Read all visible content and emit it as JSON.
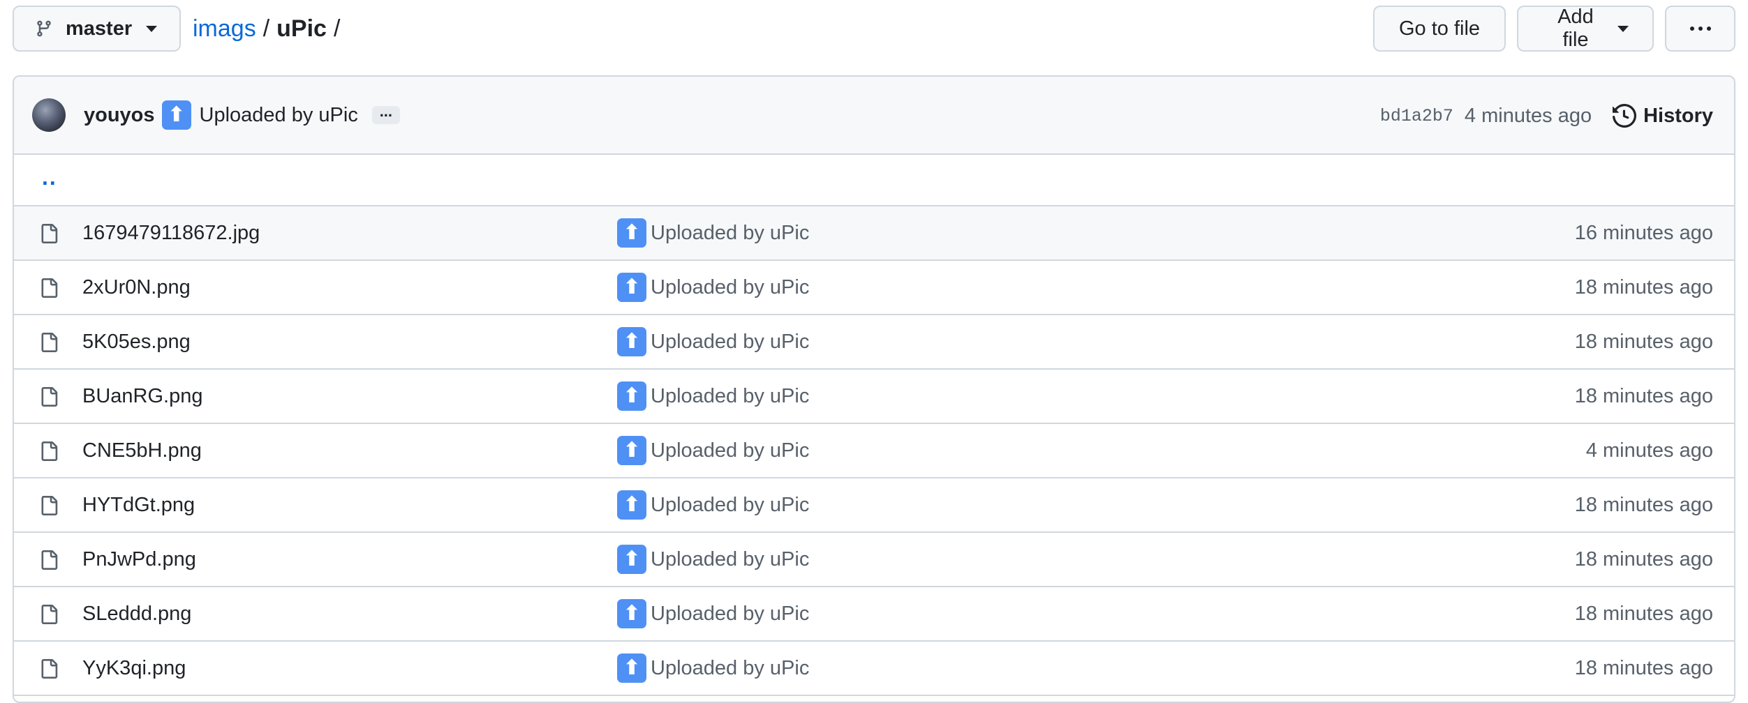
{
  "branch": {
    "name": "master"
  },
  "breadcrumb": {
    "repo": "imags",
    "folder": "uPic",
    "sep1": "/",
    "sep2": "/"
  },
  "actions": {
    "go_to_file": "Go to file",
    "add_file": "Add file"
  },
  "commit": {
    "author": "youyos",
    "emoji": "⬆",
    "message": "Uploaded by uPic",
    "ellipsis": "...",
    "sha": "bd1a2b7",
    "time": "4 minutes ago",
    "history_label": "History"
  },
  "parent_dir": "..",
  "files": [
    {
      "name": "1679479118672.jpg",
      "message": "Uploaded by uPic",
      "time": "16 minutes ago"
    },
    {
      "name": "2xUr0N.png",
      "message": "Uploaded by uPic",
      "time": "18 minutes ago"
    },
    {
      "name": "5K05es.png",
      "message": "Uploaded by uPic",
      "time": "18 minutes ago"
    },
    {
      "name": "BUanRG.png",
      "message": "Uploaded by uPic",
      "time": "18 minutes ago"
    },
    {
      "name": "CNE5bH.png",
      "message": "Uploaded by uPic",
      "time": "4 minutes ago"
    },
    {
      "name": "HYTdGt.png",
      "message": "Uploaded by uPic",
      "time": "18 minutes ago"
    },
    {
      "name": "PnJwPd.png",
      "message": "Uploaded by uPic",
      "time": "18 minutes ago"
    },
    {
      "name": "SLeddd.png",
      "message": "Uploaded by uPic",
      "time": "18 minutes ago"
    },
    {
      "name": "YyK3qi.png",
      "message": "Uploaded by uPic",
      "time": "18 minutes ago"
    }
  ],
  "colors": {
    "link": "#0969da",
    "border": "#d0d7de",
    "muted": "#57606a",
    "emoji_bg": "#4f90f5"
  }
}
